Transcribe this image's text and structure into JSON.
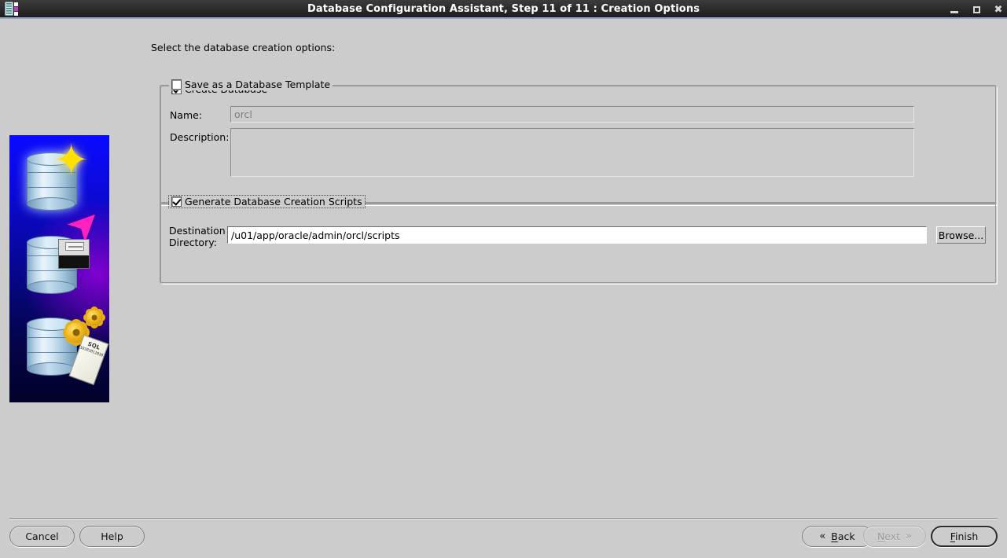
{
  "window": {
    "title": "Database Configuration Assistant, Step 11 of 11 : Creation Options",
    "app_icon": "database-app-icon",
    "controls": {
      "minimize": "minimize-button",
      "maximize": "maximize-button",
      "close": "close-button",
      "close_glyph": "✖"
    },
    "titlebar_color": "#2e2e2e",
    "accent_color": "#8fa8c8",
    "background_color": "#cccccc"
  },
  "sidebar": {
    "alt": "Oracle database creation illustration",
    "sql_scroll_label": "SQL",
    "sql_scroll_bits": "101010110101011010101101010110101011010101101010110101",
    "gradient_start": "#0a0aff",
    "gradient_end": "#020229",
    "star_color": "#ffe000",
    "arrow_color": "#ff22c0"
  },
  "main": {
    "intro_label": "Select the database creation options:",
    "create_database": {
      "label": "Create Database",
      "checked": true
    },
    "template_group": {
      "title": "Save as a Database Template",
      "checked": false,
      "name_label": "Name:",
      "name_value": "orcl",
      "name_enabled": false,
      "description_label": "Description:",
      "description_value": "",
      "description_enabled": false
    },
    "scripts_group": {
      "title": "Generate Database Creation Scripts",
      "checked": true,
      "focused": true,
      "destination_label_line1": "Destination",
      "destination_label_line2": "Directory:",
      "destination_value": "/u01/app/oracle/admin/orcl/scripts",
      "browse_label": "Browse..."
    }
  },
  "footer": {
    "cancel": "Cancel",
    "help": "Help",
    "back": {
      "label": "Back",
      "mnemonic": "B",
      "rest": "ack",
      "chevron": "«",
      "enabled": true
    },
    "next": {
      "label": "Next",
      "mnemonic": "N",
      "rest": "ext",
      "chevron": "»",
      "enabled": false
    },
    "finish": {
      "label": "Finish",
      "mnemonic": "F",
      "rest": "inish",
      "default": true,
      "enabled": true
    }
  }
}
